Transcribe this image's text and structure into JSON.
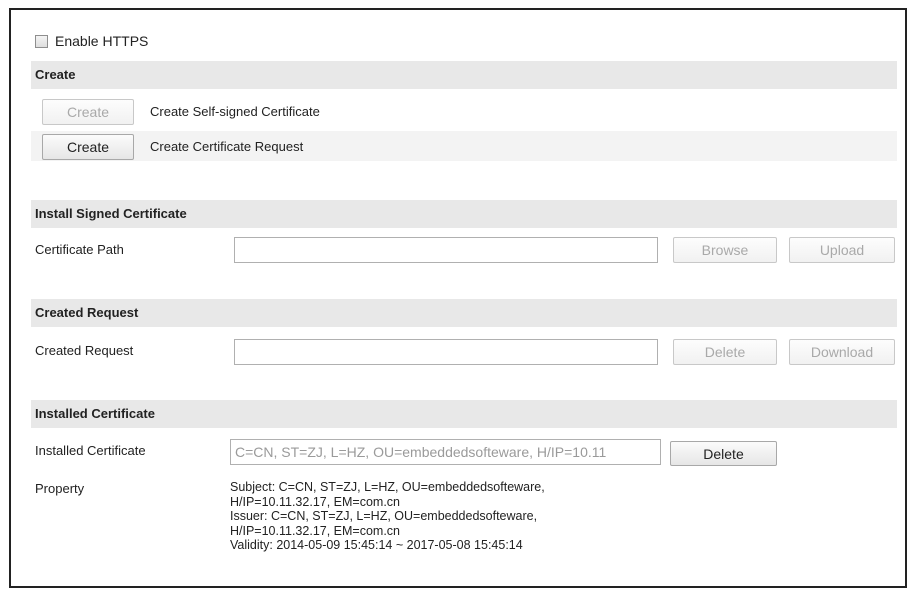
{
  "https": {
    "enable_label": "Enable HTTPS",
    "checked": false
  },
  "create": {
    "section_title": "Create",
    "self_signed": {
      "button_label": "Create",
      "description": "Create Self-signed Certificate",
      "enabled": false
    },
    "request": {
      "button_label": "Create",
      "description": "Create Certificate Request",
      "enabled": true
    }
  },
  "install_signed": {
    "section_title": "Install Signed Certificate",
    "path_label": "Certificate Path",
    "path_value": "",
    "browse_label": "Browse",
    "upload_label": "Upload"
  },
  "created_request": {
    "section_title": "Created Request",
    "label": "Created Request",
    "value": "",
    "delete_label": "Delete",
    "download_label": "Download"
  },
  "installed": {
    "section_title": "Installed Certificate",
    "label": "Installed Certificate",
    "value": "C=CN, ST=ZJ, L=HZ, OU=embeddedsofteware, H/IP=10.11",
    "delete_label": "Delete",
    "property_label": "Property",
    "property_lines": [
      "Subject: C=CN, ST=ZJ, L=HZ, OU=embeddedsofteware,",
      "H/IP=10.11.32.17, EM=com.cn",
      "Issuer: C=CN, ST=ZJ, L=HZ, OU=embeddedsofteware,",
      "H/IP=10.11.32.17, EM=com.cn",
      "Validity: 2014-05-09 15:45:14 ~ 2017-05-08 15:45:14"
    ]
  }
}
